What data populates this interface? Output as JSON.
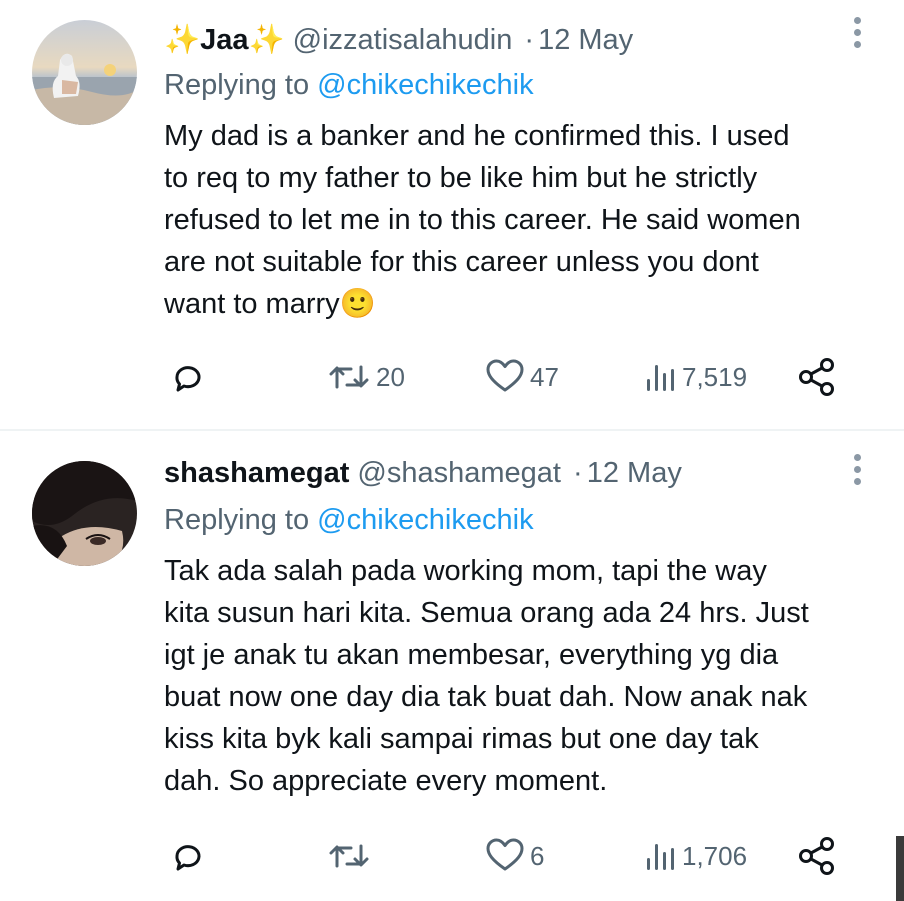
{
  "tweets": [
    {
      "display_name": "✨Jaa✨",
      "handle": "@izzatisalahudin",
      "separator": "·",
      "date": "12 May",
      "replying_prefix": "Replying to",
      "replying_to": "@chikechikechik",
      "lines": [
        "My dad is a banker and he confirmed this. I used",
        "to req to my father to be like him but he strictly",
        "refused to let me in to this career. He said women",
        "are not suitable for this career unless you dont",
        "want to marry🙂"
      ],
      "actions": {
        "retweets": "20",
        "likes": "47",
        "views": "7,519"
      }
    },
    {
      "display_name": "shashamegat",
      "handle": "@shashamegat",
      "separator": "·",
      "date": "12 May",
      "replying_prefix": "Replying to",
      "replying_to": "@chikechikechik",
      "lines": [
        "Tak ada salah pada working mom, tapi the way",
        "kita susun hari kita. Semua orang ada 24 hrs. Just",
        "igt je anak tu akan membesar, everything yg dia",
        "buat now one day dia tak buat dah. Now anak nak",
        "kiss kita byk kali sampai rimas but one day tak",
        "dah. So appreciate every moment."
      ],
      "actions": {
        "retweets": "",
        "likes": "6",
        "views": "1,706"
      }
    }
  ],
  "icons": {
    "reply": "reply-icon",
    "retweet": "retweet-icon",
    "like": "heart-icon",
    "views": "views-icon",
    "share": "share-icon",
    "more": "more-options-icon"
  },
  "colors": {
    "text": "#0f1419",
    "secondary": "#536471",
    "link": "#1d9bf0"
  }
}
